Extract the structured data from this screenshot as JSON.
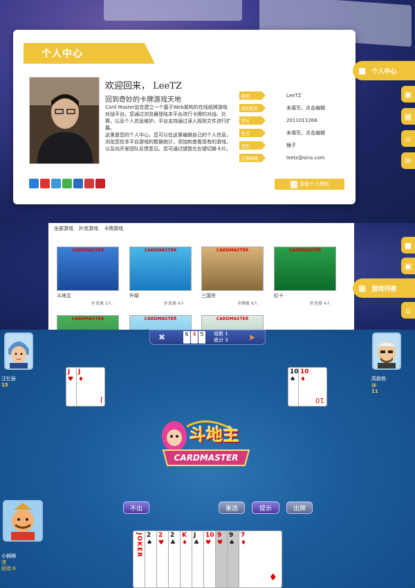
{
  "profile": {
    "title": "个人中心",
    "welcome": "欢迎回来， LeeTZ",
    "slogan": "回到奇妙的卡牌游戏天地",
    "desc1": "Card Master旨在建立一个基于Web架构的在线纸牌游戏对战平台。您通过浏览器登陆本平台进行卡牌的对战、比赛，以及个人信息维护。平台支持通过读入规则文件进行扩展。",
    "desc2": "这里是您的个人中心，您可以在这里编辑自己的个人信息，浏览您在本平台游戏的数据统计，添加和查看现有的游戏，以及向开发团队反馈意见。您可通过键盘左右键切换卡片。",
    "fields": [
      {
        "label": "昵称",
        "value": "LeeTZ"
      },
      {
        "label": "真实姓名",
        "value": "未填写，点击编辑"
      },
      {
        "label": "学号",
        "value": "2011011268"
      },
      {
        "label": "生日",
        "value": "未填写，点击编辑"
      },
      {
        "label": "性别",
        "value": "猴子"
      },
      {
        "label": "注册邮箱",
        "value": "leetz@sina.com"
      }
    ],
    "update_btn": "更新个人资料",
    "side_tab": "个人中心",
    "social_colors": [
      "#2a7fd4",
      "#e0332c",
      "#3a9ad8",
      "#44b34a",
      "#2a6cc0",
      "#d23a3a",
      "#c9202a"
    ]
  },
  "games": {
    "tabs": [
      "全部游戏",
      "扑克游戏",
      "卡牌游戏"
    ],
    "side_tab": "游戏列表",
    "items": [
      {
        "brand": "CARDMASTER",
        "name": "斗地主",
        "meta": "扑克类 3人",
        "color": "#2a6cc8"
      },
      {
        "brand": "CARDMASTER",
        "name": "升级",
        "meta": "扑克类 4人",
        "color": "#2aa0d8"
      },
      {
        "brand": "CARDMASTER",
        "name": "三国杀",
        "meta": "卡牌类 8人",
        "color": "#b08a4a"
      },
      {
        "brand": "CARDMASTER",
        "name": "红十",
        "meta": "扑克类 4人",
        "color": "#1a8a3a"
      },
      {
        "brand": "CARDMASTER",
        "name": "",
        "meta": "",
        "color": "#3a8a4a"
      },
      {
        "brand": "CARDMASTER",
        "name": "",
        "meta": "",
        "color": "#7ac8e8"
      },
      {
        "brand": "CARDMASTER",
        "name": "",
        "meta": "",
        "color": "#a8c0b0"
      }
    ]
  },
  "game": {
    "topbar": {
      "multiplier_label": "倍数",
      "multiplier": "1",
      "base_label": "底分",
      "base": "3",
      "cards": [
        "6",
        "4",
        "5"
      ]
    },
    "left_player": {
      "name": "汪忆辰",
      "count": "15"
    },
    "right_player": {
      "name": "高欲杨",
      "rank": "神",
      "count": "11"
    },
    "self_player": {
      "name": "小狮狮",
      "rank": "渣",
      "exp": "经验:6"
    },
    "left_played": [
      "J",
      "J"
    ],
    "right_played": [
      "10",
      "10"
    ],
    "buttons": {
      "pass": "不出",
      "reselect": "重选",
      "hint": "提示",
      "play": "出牌"
    },
    "logo_text": "斗地主",
    "logo_brand": "CARDMASTER",
    "hand": [
      {
        "rank": "JOKER",
        "color": "red"
      },
      {
        "rank": "2",
        "color": "blk"
      },
      {
        "rank": "2",
        "color": "red"
      },
      {
        "rank": "2",
        "color": "blk"
      },
      {
        "rank": "K",
        "color": "red"
      },
      {
        "rank": "J",
        "color": "blk"
      },
      {
        "rank": "10",
        "color": "red"
      },
      {
        "rank": "9",
        "color": "red"
      },
      {
        "rank": "9",
        "color": "blk"
      },
      {
        "rank": "7",
        "color": "red"
      }
    ]
  }
}
